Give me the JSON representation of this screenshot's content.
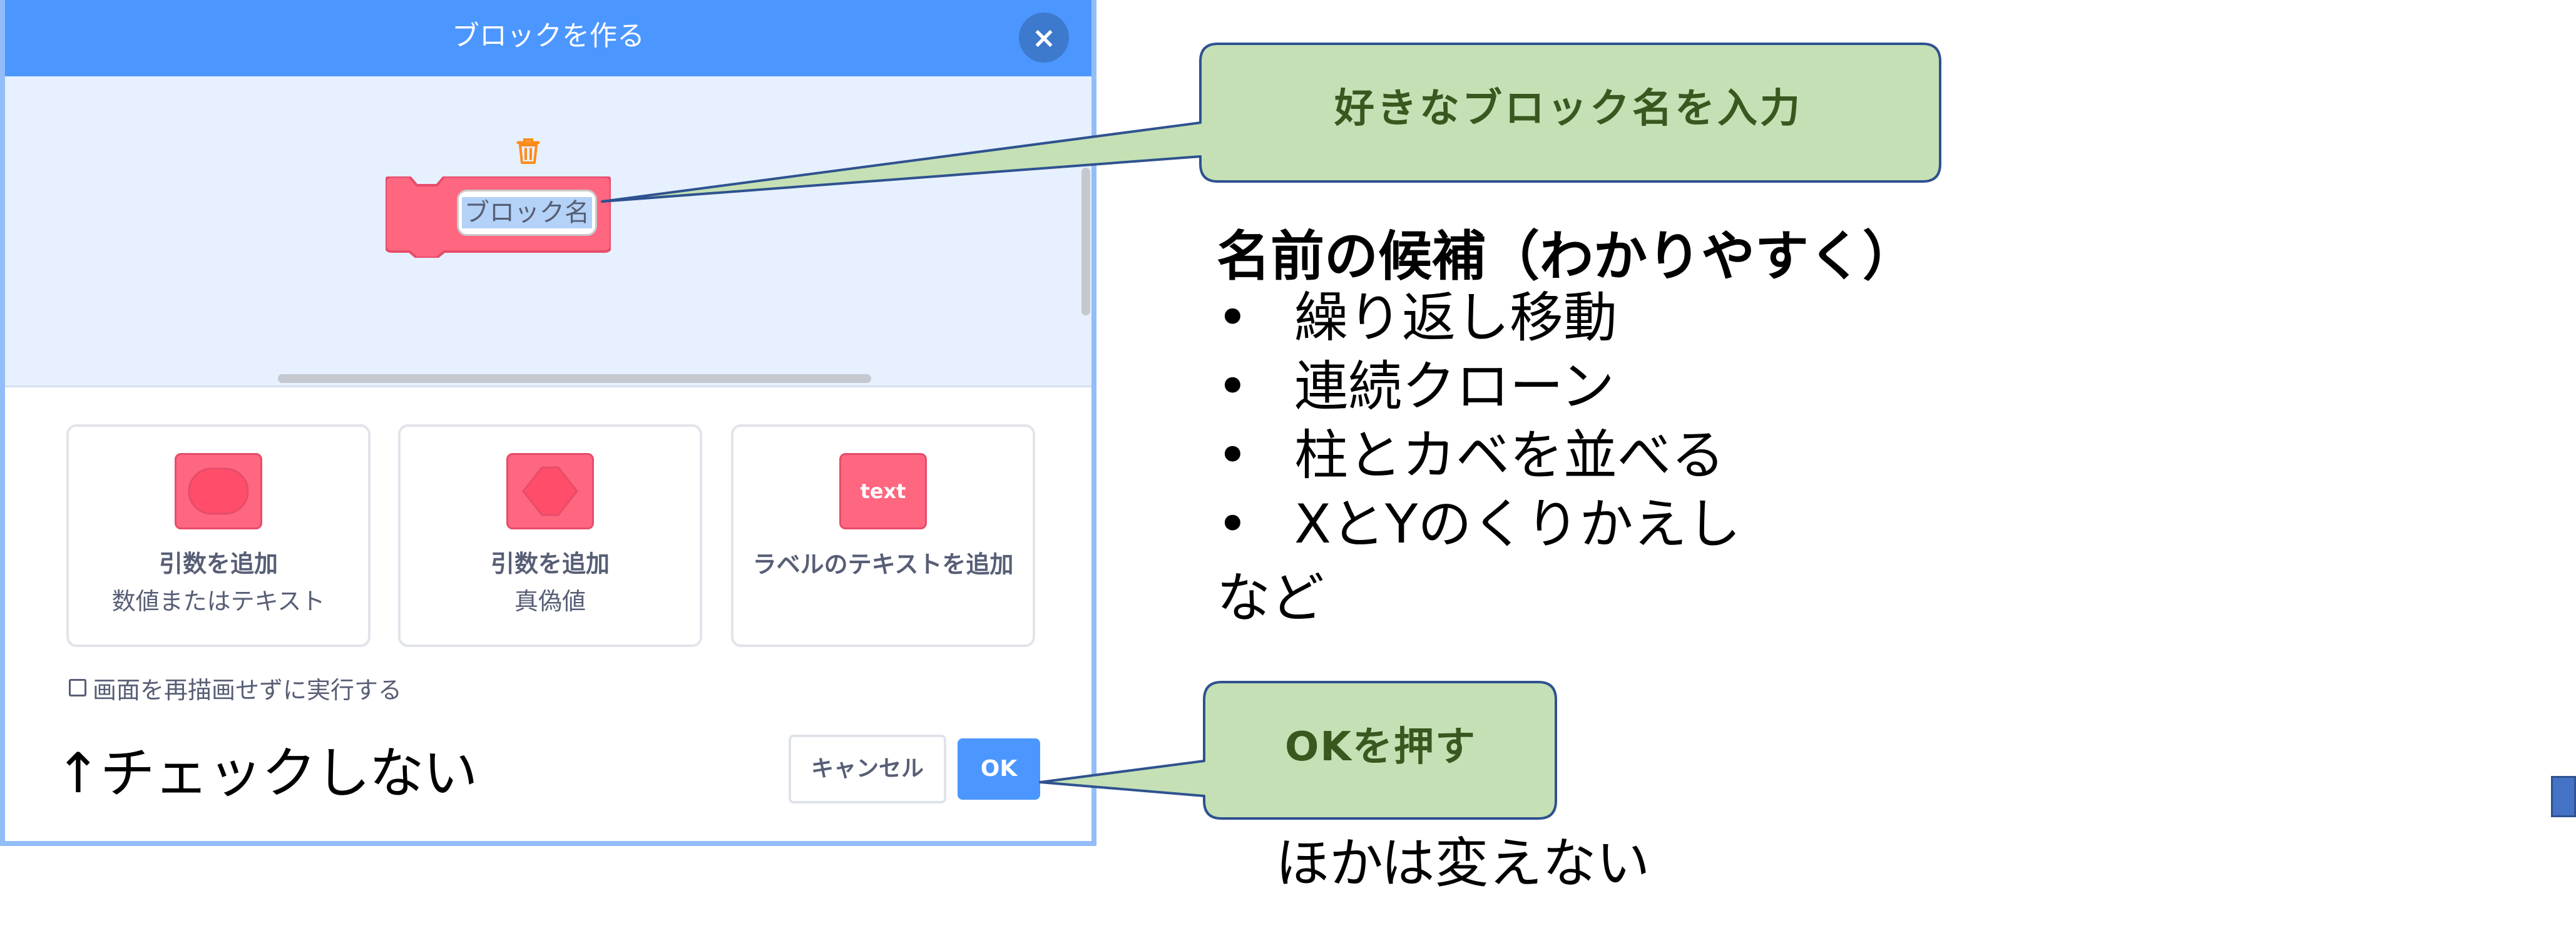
{
  "dialog": {
    "title": "ブロックを作る",
    "close_icon": "×",
    "block_name_placeholder": "ブロック名",
    "options": [
      {
        "title": "引数を追加",
        "subtitle": "数値またはテキスト",
        "icon": "round-reporter-icon"
      },
      {
        "title": "引数を追加",
        "subtitle": "真偽値",
        "icon": "hexagon-boolean-icon"
      },
      {
        "title": "ラベルのテキストを追加",
        "subtitle": "",
        "icon_text": "text"
      }
    ],
    "run_without_refresh_label": "画面を再描画せずに実行する",
    "run_without_refresh_checked": false,
    "cancel_label": "キャンセル",
    "ok_label": "OK"
  },
  "annotations": {
    "dont_check": "↑チェックしない",
    "callout_block_name": "好きなブロック名を入力",
    "callout_ok": "OKを押す",
    "candidates_heading": "名前の候補（わかりやすく）",
    "candidates": [
      "繰り返し移動",
      "連続クローン",
      "柱とカベを並べる",
      "XとYのくりかえし"
    ],
    "bullet_char": "•",
    "etc": "など",
    "others_note": "ほかは変えない"
  },
  "colors": {
    "header_blue": "#4c97ff",
    "workspace_bg": "#e6f0ff",
    "block_pink": "#ff6680",
    "callout_fill": "#c5e0b4",
    "callout_border": "#2f528f",
    "callout_text": "#38581f"
  }
}
